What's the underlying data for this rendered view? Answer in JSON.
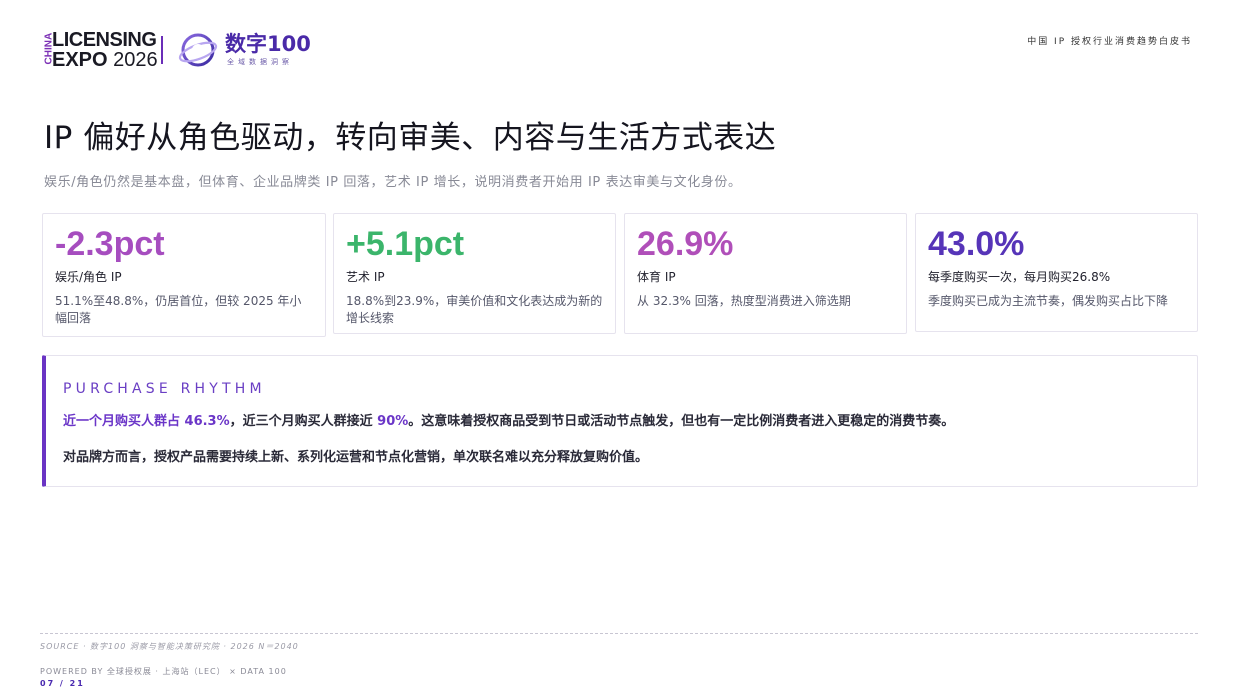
{
  "header": {
    "logo_china": "CHINA",
    "logo_licensing": "LICENSING",
    "logo_expo": "EXPO",
    "logo_year": "2026",
    "logo_brand": "数字100",
    "logo_brand_sub": "全域数据洞察",
    "doc_title": "中国 IP 授权行业消费趋势白皮书"
  },
  "title": "IP 偏好从角色驱动，转向审美、内容与生活方式表达",
  "subtitle": "娱乐/角色仍然是基本盘，但体育、企业品牌类 IP 回落，艺术 IP 增长，说明消费者开始用 IP 表达审美与文化身份。",
  "cards": [
    {
      "value": "-2.3pct",
      "label": "娱乐/角色 IP",
      "desc": "51.1%至48.8%，仍居首位，但较 2025 年小幅回落",
      "color": "#a64dbf"
    },
    {
      "value": "+5.1pct",
      "label": "艺术 IP",
      "desc": "18.8%到23.9%，审美价值和文化表达成为新的增长线索",
      "color": "#3bb56b"
    },
    {
      "value": "26.9%",
      "label": "体育 IP",
      "desc": "从 32.3% 回落，热度型消费进入筛选期",
      "color": "#b04fb9"
    },
    {
      "value": "43.0%",
      "label": "每季度购买一次，每月购买26.8%",
      "desc": "季度购买已成为主流节奏，偶发购买占比下降",
      "color": "#5634b8"
    }
  ],
  "panel": {
    "title": "PURCHASE RHYTHM",
    "line1_hl1": "近一个月购买人群占 46.3%",
    "line1_mid": "，近三个月购买人群接近 ",
    "line1_hl2": "90%",
    "line1_end": "。这意味着授权商品受到节日或活动节点触发，但也有一定比例消费者进入更稳定的消费节奏。",
    "line2": "对品牌方而言，授权产品需要持续上新、系列化运营和节点化营销，单次联名难以充分释放复购价值。"
  },
  "footer": {
    "source": "SOURCE · 数字100 洞察与智能决策研究院 · 2026 N＝2040",
    "powered": "POWERED BY 全球授权展 · 上海站（LEC） × DATA 100",
    "page": "07 / 21"
  },
  "colors": {
    "accent_purple": "#6a34c4",
    "negative_pink": "#a64dbf",
    "positive_green": "#3bb56b"
  }
}
